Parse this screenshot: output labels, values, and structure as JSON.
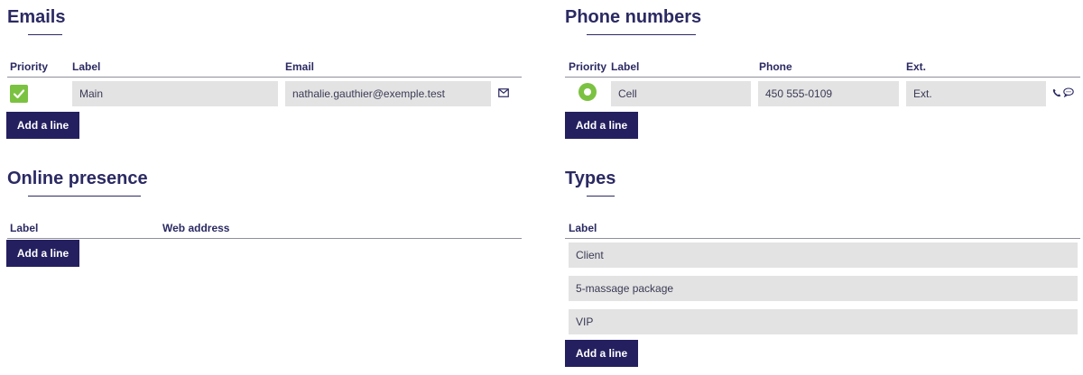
{
  "emails": {
    "title": "Emails",
    "headers": {
      "priority": "Priority",
      "label": "Label",
      "email": "Email"
    },
    "rows": [
      {
        "priority_checked": true,
        "label": "Main",
        "email": "nathalie.gauthier@exemple.test",
        "icon": "envelope-icon"
      }
    ],
    "add_button": "Add a line"
  },
  "phones": {
    "title": "Phone numbers",
    "headers": {
      "priority": "Priority",
      "label": "Label",
      "phone": "Phone",
      "ext": "Ext."
    },
    "rows": [
      {
        "priority_selected": true,
        "label": "Cell",
        "phone": "450 555-0109",
        "ext": "Ext.",
        "icons": [
          "phone-icon",
          "chat-bubble-icon"
        ]
      }
    ],
    "add_button": "Add a line"
  },
  "online": {
    "title": "Online presence",
    "headers": {
      "label": "Label",
      "web_address": "Web address"
    },
    "rows": [],
    "add_button": "Add a line"
  },
  "types": {
    "title": "Types",
    "headers": {
      "label": "Label"
    },
    "rows": [
      "Client",
      "5-massage package",
      "VIP"
    ],
    "add_button": "Add a line"
  },
  "colors": {
    "primary": "#242060",
    "accent_green": "#7cc242",
    "field_bg": "#e3e3e3"
  }
}
